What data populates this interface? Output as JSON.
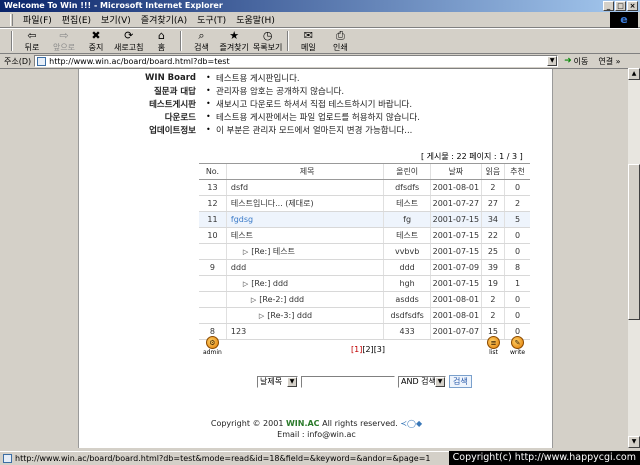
{
  "window": {
    "title": "Welcome To Win !!! - Microsoft Internet Explorer",
    "controls": [
      "_",
      "□",
      "×"
    ],
    "logo": "e"
  },
  "menu": [
    "파일(F)",
    "편집(E)",
    "보기(V)",
    "즐겨찾기(A)",
    "도구(T)",
    "도움말(H)"
  ],
  "toolbar": [
    {
      "label": "뒤로",
      "icon": "back-arrow-icon",
      "glyph": "⇦",
      "enabled": true
    },
    {
      "label": "앞으로",
      "icon": "forward-arrow-icon",
      "glyph": "⇨",
      "enabled": false
    },
    {
      "label": "중지",
      "icon": "stop-icon",
      "glyph": "✖",
      "enabled": true
    },
    {
      "label": "새로고침",
      "icon": "refresh-icon",
      "glyph": "⟳",
      "enabled": true
    },
    {
      "label": "홈",
      "icon": "home-icon",
      "glyph": "⌂",
      "enabled": true
    },
    {
      "label": "검색",
      "icon": "search-icon",
      "glyph": "⌕",
      "enabled": true
    },
    {
      "label": "즐겨찾기",
      "icon": "favorites-icon",
      "glyph": "★",
      "enabled": true
    },
    {
      "label": "목록보기",
      "icon": "history-icon",
      "glyph": "◷",
      "enabled": true
    },
    {
      "label": "메일",
      "icon": "mail-icon",
      "glyph": "✉",
      "enabled": true
    },
    {
      "label": "인쇄",
      "icon": "print-icon",
      "glyph": "⎙",
      "enabled": true
    }
  ],
  "address": {
    "label": "주소(D)",
    "url": "http://www.win.ac/board/board.html?db=test",
    "go_label": "이동",
    "links_label": "연결 »"
  },
  "info": [
    {
      "key": "WIN Board",
      "text": "테스트용 게시판입니다."
    },
    {
      "key": "질문과 대답",
      "text": "관리자용 암호는 공개하지 않습니다."
    },
    {
      "key": "테스트게시판",
      "text": "새보시고 다운로드 하셔서 직접 테스트하시기 바랍니다."
    },
    {
      "key": "다운로드",
      "text": "테스트용 게시판에서는 파일 업로드를 허용하지 않습니다."
    },
    {
      "key": "업데이트정보",
      "text": "이 부분은 관리자 모드에서 얼마든지 변경 가능합니다..."
    }
  ],
  "bullet": "•",
  "board_meta": "[ 게시물 : 22     페이지 : 1 / 3 ]",
  "table": {
    "headers": [
      "No.",
      "제목",
      "올린이",
      "날짜",
      "읽음",
      "추천"
    ],
    "rows": [
      {
        "no": "13",
        "title": "dsfd",
        "author": "dfsdfs",
        "date": "2001-08-01",
        "read": "2",
        "rec": "0",
        "depth": 0,
        "selected": false
      },
      {
        "no": "12",
        "title": "테스트입니다... (제대로)",
        "author": "테스트",
        "date": "2001-07-27",
        "read": "27",
        "rec": "2",
        "depth": 0,
        "selected": false
      },
      {
        "no": "11",
        "title": "fgdsg",
        "author": "fg",
        "date": "2001-07-15",
        "read": "34",
        "rec": "5",
        "depth": 0,
        "selected": true
      },
      {
        "no": "10",
        "title": "테스트",
        "author": "테스트",
        "date": "2001-07-15",
        "read": "22",
        "rec": "0",
        "depth": 0,
        "selected": false
      },
      {
        "no": "",
        "title": "[Re:] 테스트",
        "author": "vvbvb",
        "date": "2001-07-15",
        "read": "25",
        "rec": "0",
        "depth": 1,
        "selected": false
      },
      {
        "no": "9",
        "title": "ddd",
        "author": "ddd",
        "date": "2001-07-09",
        "read": "39",
        "rec": "8",
        "depth": 0,
        "selected": false
      },
      {
        "no": "",
        "title": "[Re:] ddd",
        "author": "hgh",
        "date": "2001-07-15",
        "read": "19",
        "rec": "1",
        "depth": 1,
        "selected": false
      },
      {
        "no": "",
        "title": "[Re-2:] ddd",
        "author": "asdds",
        "date": "2001-08-01",
        "read": "2",
        "rec": "0",
        "depth": 2,
        "selected": false
      },
      {
        "no": "",
        "title": "[Re-3:] ddd",
        "author": "dsdfsdfs",
        "date": "2001-08-01",
        "read": "2",
        "rec": "0",
        "depth": 3,
        "selected": false
      },
      {
        "no": "8",
        "title": "123",
        "author": "433",
        "date": "2001-07-07",
        "read": "15",
        "rec": "0",
        "depth": 0,
        "selected": false
      }
    ],
    "reply_arrow": "▷"
  },
  "buttons": {
    "admin": "admin",
    "list": "list",
    "write": "write"
  },
  "pager": {
    "pages": [
      "[1]",
      "[2]",
      "[3]"
    ],
    "current": "[1]"
  },
  "search": {
    "field": "날제목",
    "mode": "AND 검색",
    "button": "검색"
  },
  "footer": {
    "line1_prefix": "Copyright © 2001 ",
    "brand": "WIN.AC",
    "line1_suffix": " All rights reserved.",
    "email": "Email : info@win.ac"
  },
  "status": {
    "url": "http://www.win.ac/board/board.html?db=test&mode=read&id=18&field=&keyword=&andor=&page=1",
    "copyright": "Copyright(c) http://www.happycgi.com"
  },
  "colors": {
    "selected_title": "#3a7ac8",
    "brand": "#2a7a2a",
    "titlebar": "#0a246a"
  }
}
